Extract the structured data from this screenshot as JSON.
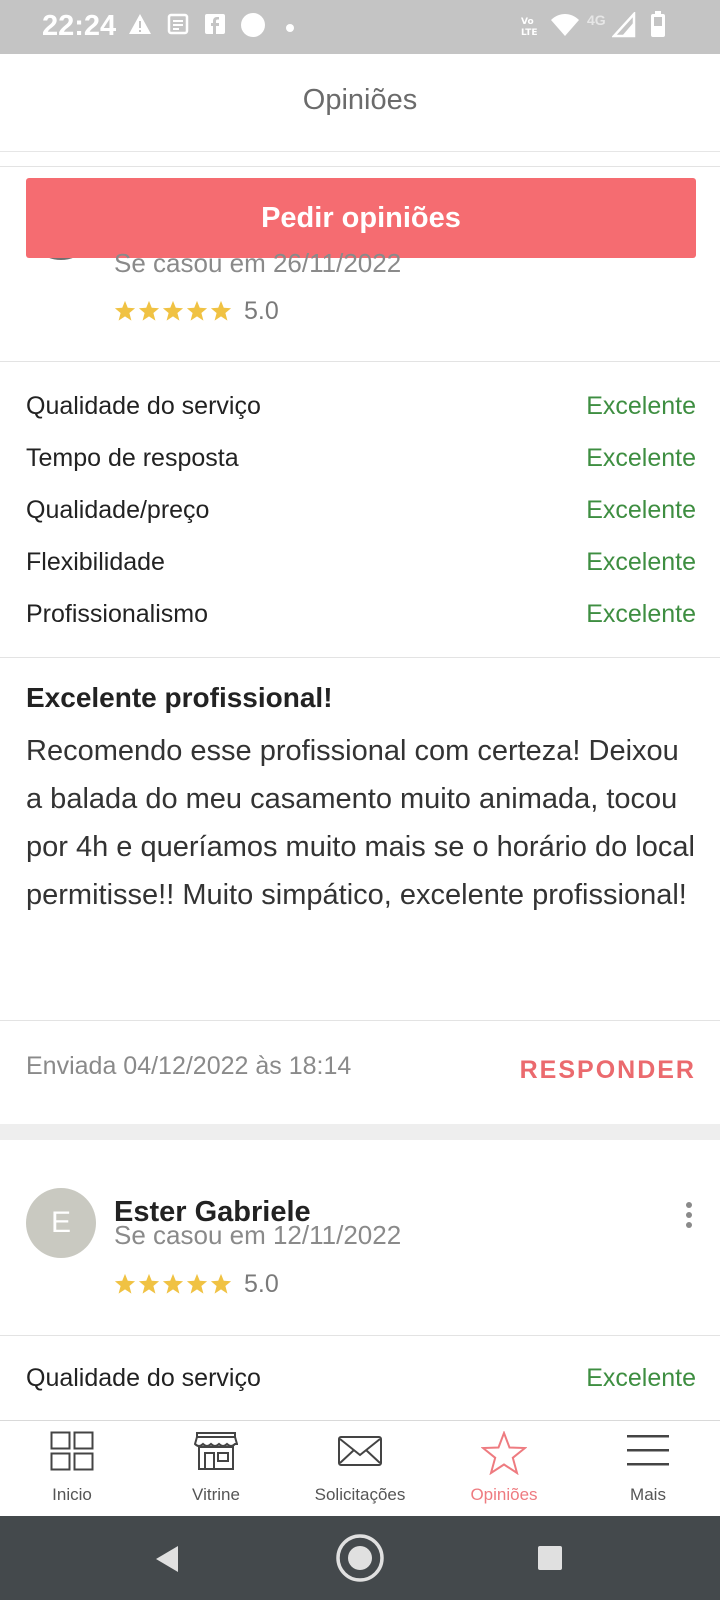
{
  "status_bar": {
    "time": "22:24",
    "left_icons": [
      "warning-icon",
      "news-icon",
      "facebook-icon",
      "circle-icon",
      "dot-icon"
    ],
    "right_icons": [
      "volte-icon",
      "wifi-icon",
      "signal-4g-icon",
      "battery-icon"
    ],
    "network_label": "4G"
  },
  "header": {
    "title": "Opiniões"
  },
  "ask_button": {
    "label": "Pedir opiniões"
  },
  "review1": {
    "married": "Se casou em 26/11/2022",
    "stars": 5,
    "score": "5.0",
    "criteria": [
      {
        "label": "Qualidade do serviço",
        "value": "Excelente"
      },
      {
        "label": "Tempo de resposta",
        "value": "Excelente"
      },
      {
        "label": "Qualidade/preço",
        "value": "Excelente"
      },
      {
        "label": "Flexibilidade",
        "value": "Excelente"
      },
      {
        "label": "Profissionalismo",
        "value": "Excelente"
      }
    ],
    "title": "Excelente profissional!",
    "body": "Recomendo esse profissional com certeza! Deixou a balada do meu casamento muito animada, tocou por 4h e queríamos muito mais se o horário do local permitisse!! Muito simpático, excelente profissional!",
    "sent": "Enviada 04/12/2022 às 18:14",
    "reply_label": "RESPONDER"
  },
  "review2": {
    "avatar_initial": "E",
    "name": "Ester Gabriele",
    "married": "Se casou em 12/11/2022",
    "stars": 5,
    "score": "5.0",
    "criteria": [
      {
        "label": "Qualidade do serviço",
        "value": "Excelente"
      }
    ]
  },
  "bottom_nav": [
    {
      "label": "Inicio",
      "icon": "grid-icon",
      "active": false
    },
    {
      "label": "Vitrine",
      "icon": "storefront-icon",
      "active": false
    },
    {
      "label": "Solicitações",
      "icon": "envelope-icon",
      "active": false
    },
    {
      "label": "Opiniões",
      "icon": "star-icon",
      "active": true
    },
    {
      "label": "Mais",
      "icon": "menu-icon",
      "active": false
    }
  ],
  "colors": {
    "accent": "#f56c71",
    "excellent": "#3e8e41",
    "star": "#f0c243",
    "status_bar": "#c4c4c4",
    "system_nav": "#44494c"
  }
}
